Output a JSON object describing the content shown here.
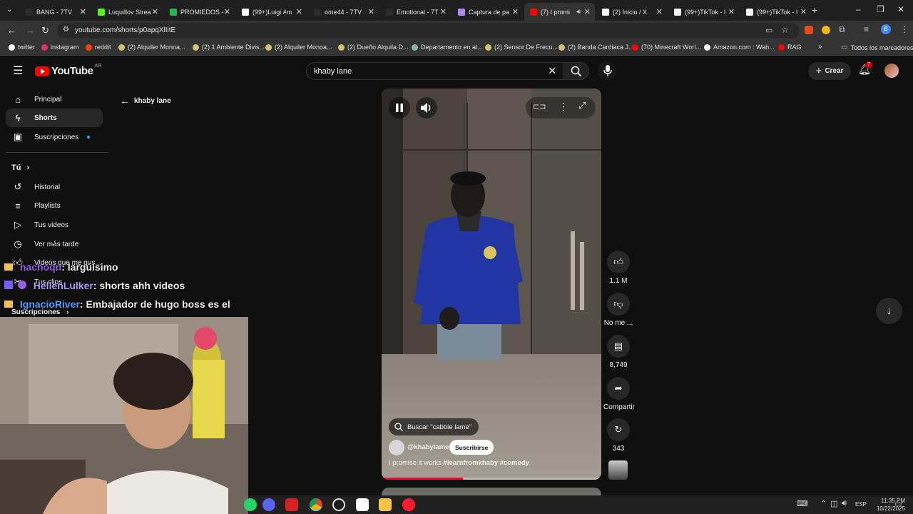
{
  "browser": {
    "tabs": [
      {
        "label": "BANG - 7TV",
        "color": "#2b2b2b"
      },
      {
        "label": "Luquillov Strea",
        "color": "#53fc18"
      },
      {
        "label": "PROMIEDOS -",
        "color": "#1db954"
      },
      {
        "label": "(99+)Luigi #m",
        "color": "#ffffff"
      },
      {
        "label": "ome44 - 7TV",
        "color": "#2b2b2b"
      },
      {
        "label": "Emotional - 7T",
        "color": "#2b2b2b"
      },
      {
        "label": "Captura de pa",
        "color": "#b388ff"
      },
      {
        "label": "(7) I promi",
        "color": "#ff0000"
      },
      {
        "label": "(2) Inicio / X",
        "color": "#ffffff"
      },
      {
        "label": "(99+)TikTok - I",
        "color": "#ffffff"
      },
      {
        "label": "(99+)TikTok - I",
        "color": "#ffffff"
      }
    ],
    "url": "youtube.com/shorts/p0apqXlIitE",
    "bookmarks": [
      {
        "label": "twitter",
        "color": "#ffffff"
      },
      {
        "label": "instagram",
        "color": "#e1306c"
      },
      {
        "label": "reddit",
        "color": "#ff4500"
      },
      {
        "label": "(2) Alquiler Monoa...",
        "color": "#d6c06a"
      },
      {
        "label": "(2) 1 Ambiente Divis...",
        "color": "#d6c06a"
      },
      {
        "label": "(2) Alquiler Monoa...",
        "color": "#d6c06a"
      },
      {
        "label": "(2) Dueño Alquila D...",
        "color": "#d6c06a"
      },
      {
        "label": "Departamento en al...",
        "color": "#8fb4a0"
      },
      {
        "label": "(2) Sensor De Frecu...",
        "color": "#d6c06a"
      },
      {
        "label": "(2) Banda Cardiaca J...",
        "color": "#d6c06a"
      },
      {
        "label": "(70) Minecraft Worl...",
        "color": "#ff0000"
      },
      {
        "label": "Amazon.com : Wah...",
        "color": "#ffffff"
      },
      {
        "label": "RAG",
        "color": "#ff0000"
      }
    ],
    "all_bookmarks": "Todos los marcadores",
    "profile_initial": "B"
  },
  "youtube": {
    "logo_text": "YouTube",
    "country": "AR",
    "search_value": "khaby lane",
    "create_label": "Crear",
    "notification_count": "7",
    "back_title": "khaby lane",
    "sidebar": {
      "main": [
        {
          "label": "Principal",
          "icon": "home-icon"
        },
        {
          "label": "Shorts",
          "icon": "shorts-icon"
        },
        {
          "label": "Suscripciones",
          "icon": "subscriptions-icon"
        }
      ],
      "you_heading": "Tú",
      "you": [
        {
          "label": "Historial",
          "icon": "history-icon"
        },
        {
          "label": "Playlists",
          "icon": "playlists-icon"
        },
        {
          "label": "Tus videos",
          "icon": "your-videos-icon"
        },
        {
          "label": "Ver más tarde",
          "icon": "watch-later-icon"
        },
        {
          "label": "Videos que me gus...",
          "icon": "liked-videos-icon"
        },
        {
          "label": "Tus clips",
          "icon": "clips-icon"
        }
      ],
      "subs_heading": "Suscripciones"
    },
    "short": {
      "search_chip": "Buscar \"cabbie lame\"",
      "channel": "@khabylame",
      "subscribe_label": "Suscribirse",
      "caption": "I promise it works",
      "hashtags": "#learnfromkhaby #comedy",
      "progress": 0.37
    },
    "actions": {
      "likes": "1.1 M",
      "dislike_label": "No me ...",
      "comments": "8,749",
      "share_label": "Compartir",
      "remix_count": "343"
    }
  },
  "stream_chat": [
    {
      "user": "nachoqn",
      "message": ": largúísimo",
      "color": "#9b5de5"
    },
    {
      "user": "HellenLulker",
      "message": ": shorts ahh videos",
      "color": "#b19cff"
    },
    {
      "user": "IgnacioRiver",
      "message": ": Embajador de hugo boss es el",
      "color": "#4aa3ff"
    }
  ],
  "taskbar": {
    "time": "11:35 PM",
    "date": "10/22/2025",
    "language": "ESP"
  }
}
